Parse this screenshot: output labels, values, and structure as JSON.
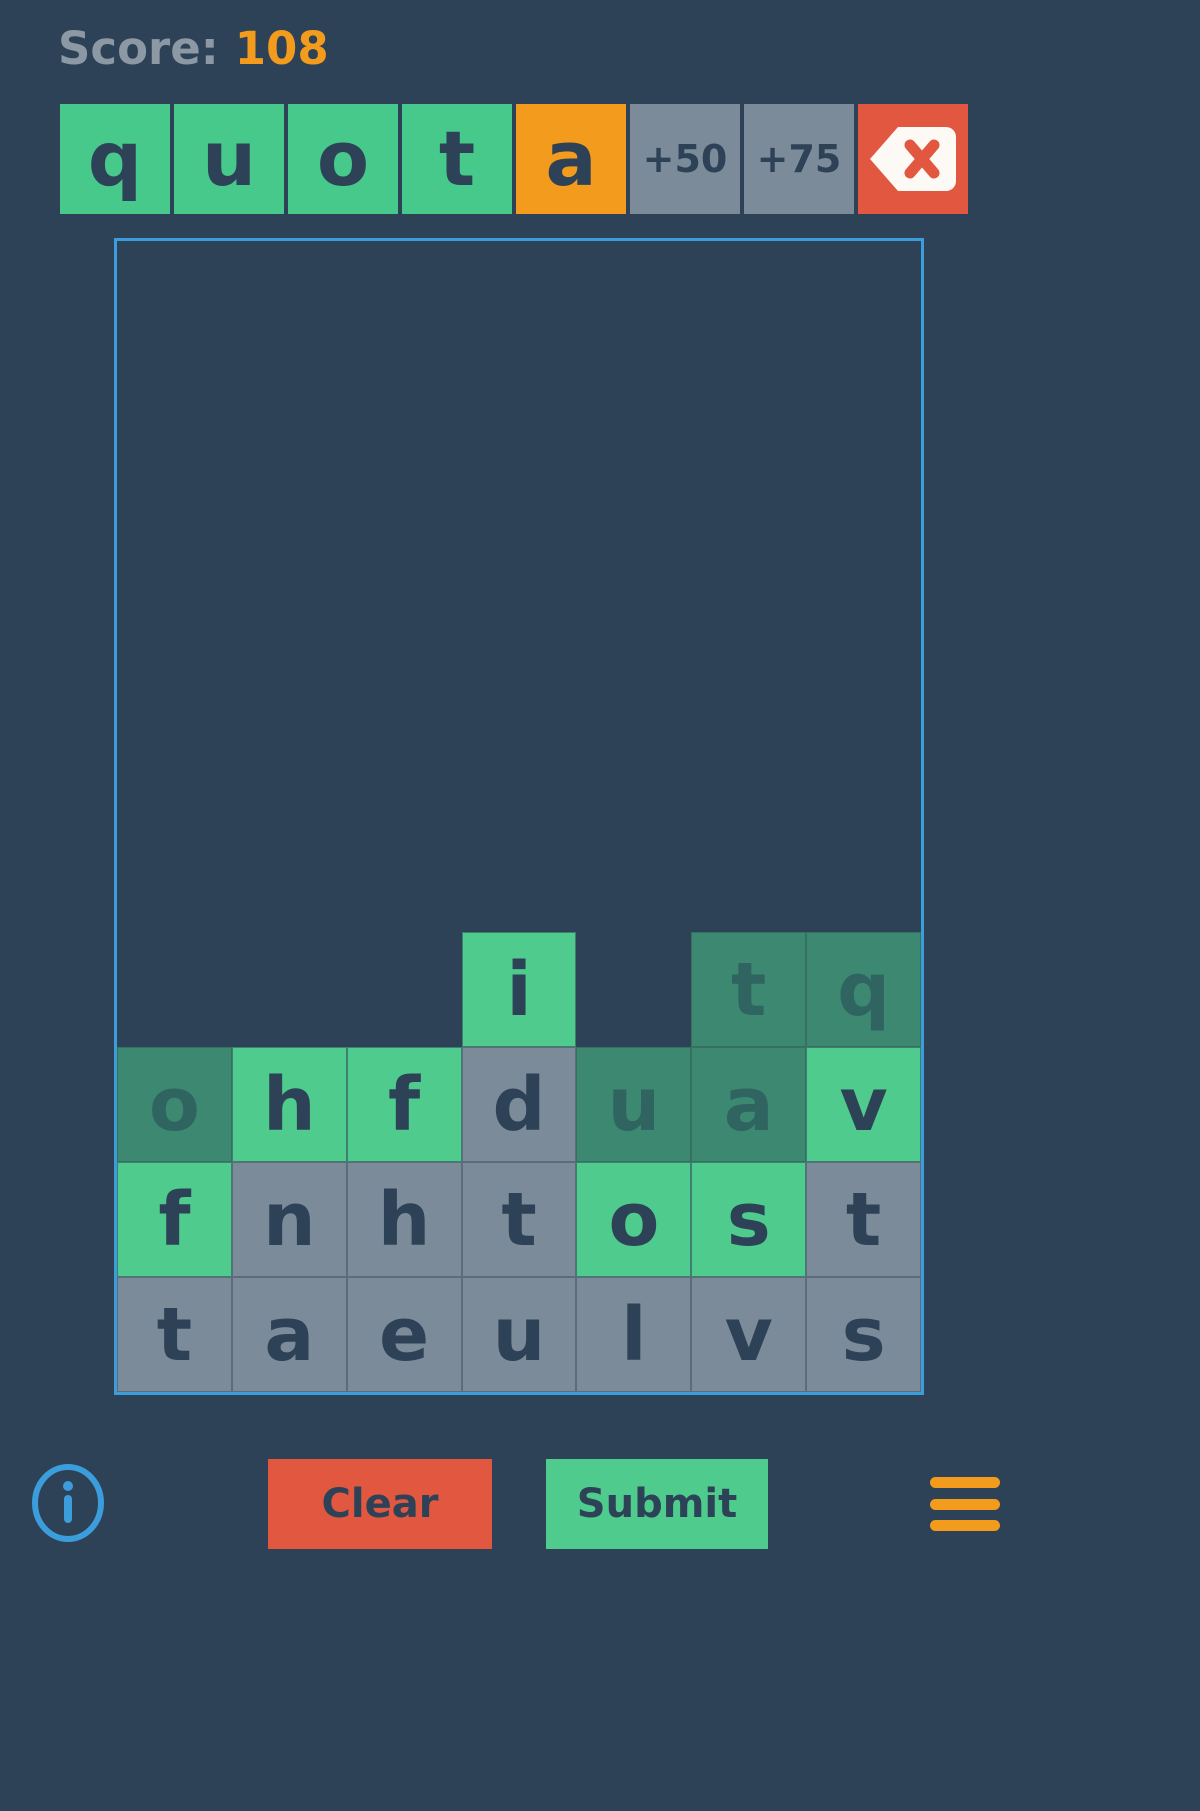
{
  "app": {
    "background_color": "#2e4257",
    "accent_orange": "#f29b1d",
    "accent_green": "#4ecb8d",
    "accent_red": "#e1573f",
    "accent_blue": "#3c9ddd",
    "tile_gray": "#7b8b9a"
  },
  "header": {
    "score_label": "Score:",
    "score_value": "108"
  },
  "word_row": {
    "tiles": [
      {
        "label": "q",
        "state": "letter-green",
        "kind": "letter"
      },
      {
        "label": "u",
        "state": "letter-green",
        "kind": "letter"
      },
      {
        "label": "o",
        "state": "letter-green",
        "kind": "letter"
      },
      {
        "label": "t",
        "state": "letter-green",
        "kind": "letter"
      },
      {
        "label": "a",
        "state": "letter-orange",
        "kind": "letter"
      },
      {
        "label": "+50",
        "state": "bonus",
        "kind": "bonus"
      },
      {
        "label": "+75",
        "state": "bonus",
        "kind": "bonus"
      }
    ],
    "backspace_icon": "backspace-delete-icon"
  },
  "board": {
    "columns": 7,
    "rows": 5,
    "grid": [
      [
        {
          "label": "",
          "state": "empty"
        },
        {
          "label": "",
          "state": "empty"
        },
        {
          "label": "",
          "state": "empty"
        },
        {
          "label": "",
          "state": "empty"
        },
        {
          "label": "",
          "state": "empty"
        },
        {
          "label": "",
          "state": "empty"
        },
        {
          "label": "",
          "state": "empty"
        }
      ],
      [
        {
          "label": "",
          "state": "empty"
        },
        {
          "label": "",
          "state": "empty"
        },
        {
          "label": "",
          "state": "empty"
        },
        {
          "label": "i",
          "state": "state-green"
        },
        {
          "label": "",
          "state": "empty"
        },
        {
          "label": "t",
          "state": "state-dim"
        },
        {
          "label": "q",
          "state": "state-dim"
        }
      ],
      [
        {
          "label": "o",
          "state": "state-dim"
        },
        {
          "label": "h",
          "state": "state-green"
        },
        {
          "label": "f",
          "state": "state-green"
        },
        {
          "label": "d",
          "state": "state-gray"
        },
        {
          "label": "u",
          "state": "state-dim"
        },
        {
          "label": "a",
          "state": "state-dim"
        },
        {
          "label": "v",
          "state": "state-green"
        }
      ],
      [
        {
          "label": "f",
          "state": "state-green"
        },
        {
          "label": "n",
          "state": "state-gray"
        },
        {
          "label": "h",
          "state": "state-gray"
        },
        {
          "label": "t",
          "state": "state-gray"
        },
        {
          "label": "o",
          "state": "state-green"
        },
        {
          "label": "s",
          "state": "state-green"
        },
        {
          "label": "t",
          "state": "state-gray"
        }
      ],
      [
        {
          "label": "t",
          "state": "state-gray"
        },
        {
          "label": "a",
          "state": "state-gray"
        },
        {
          "label": "e",
          "state": "state-gray"
        },
        {
          "label": "u",
          "state": "state-gray"
        },
        {
          "label": "l",
          "state": "state-gray"
        },
        {
          "label": "v",
          "state": "state-gray"
        },
        {
          "label": "s",
          "state": "state-gray"
        }
      ]
    ]
  },
  "bottom_bar": {
    "info_icon": "info-circle-icon",
    "clear_label": "Clear",
    "submit_label": "Submit",
    "menu_icon": "hamburger-menu-icon"
  }
}
